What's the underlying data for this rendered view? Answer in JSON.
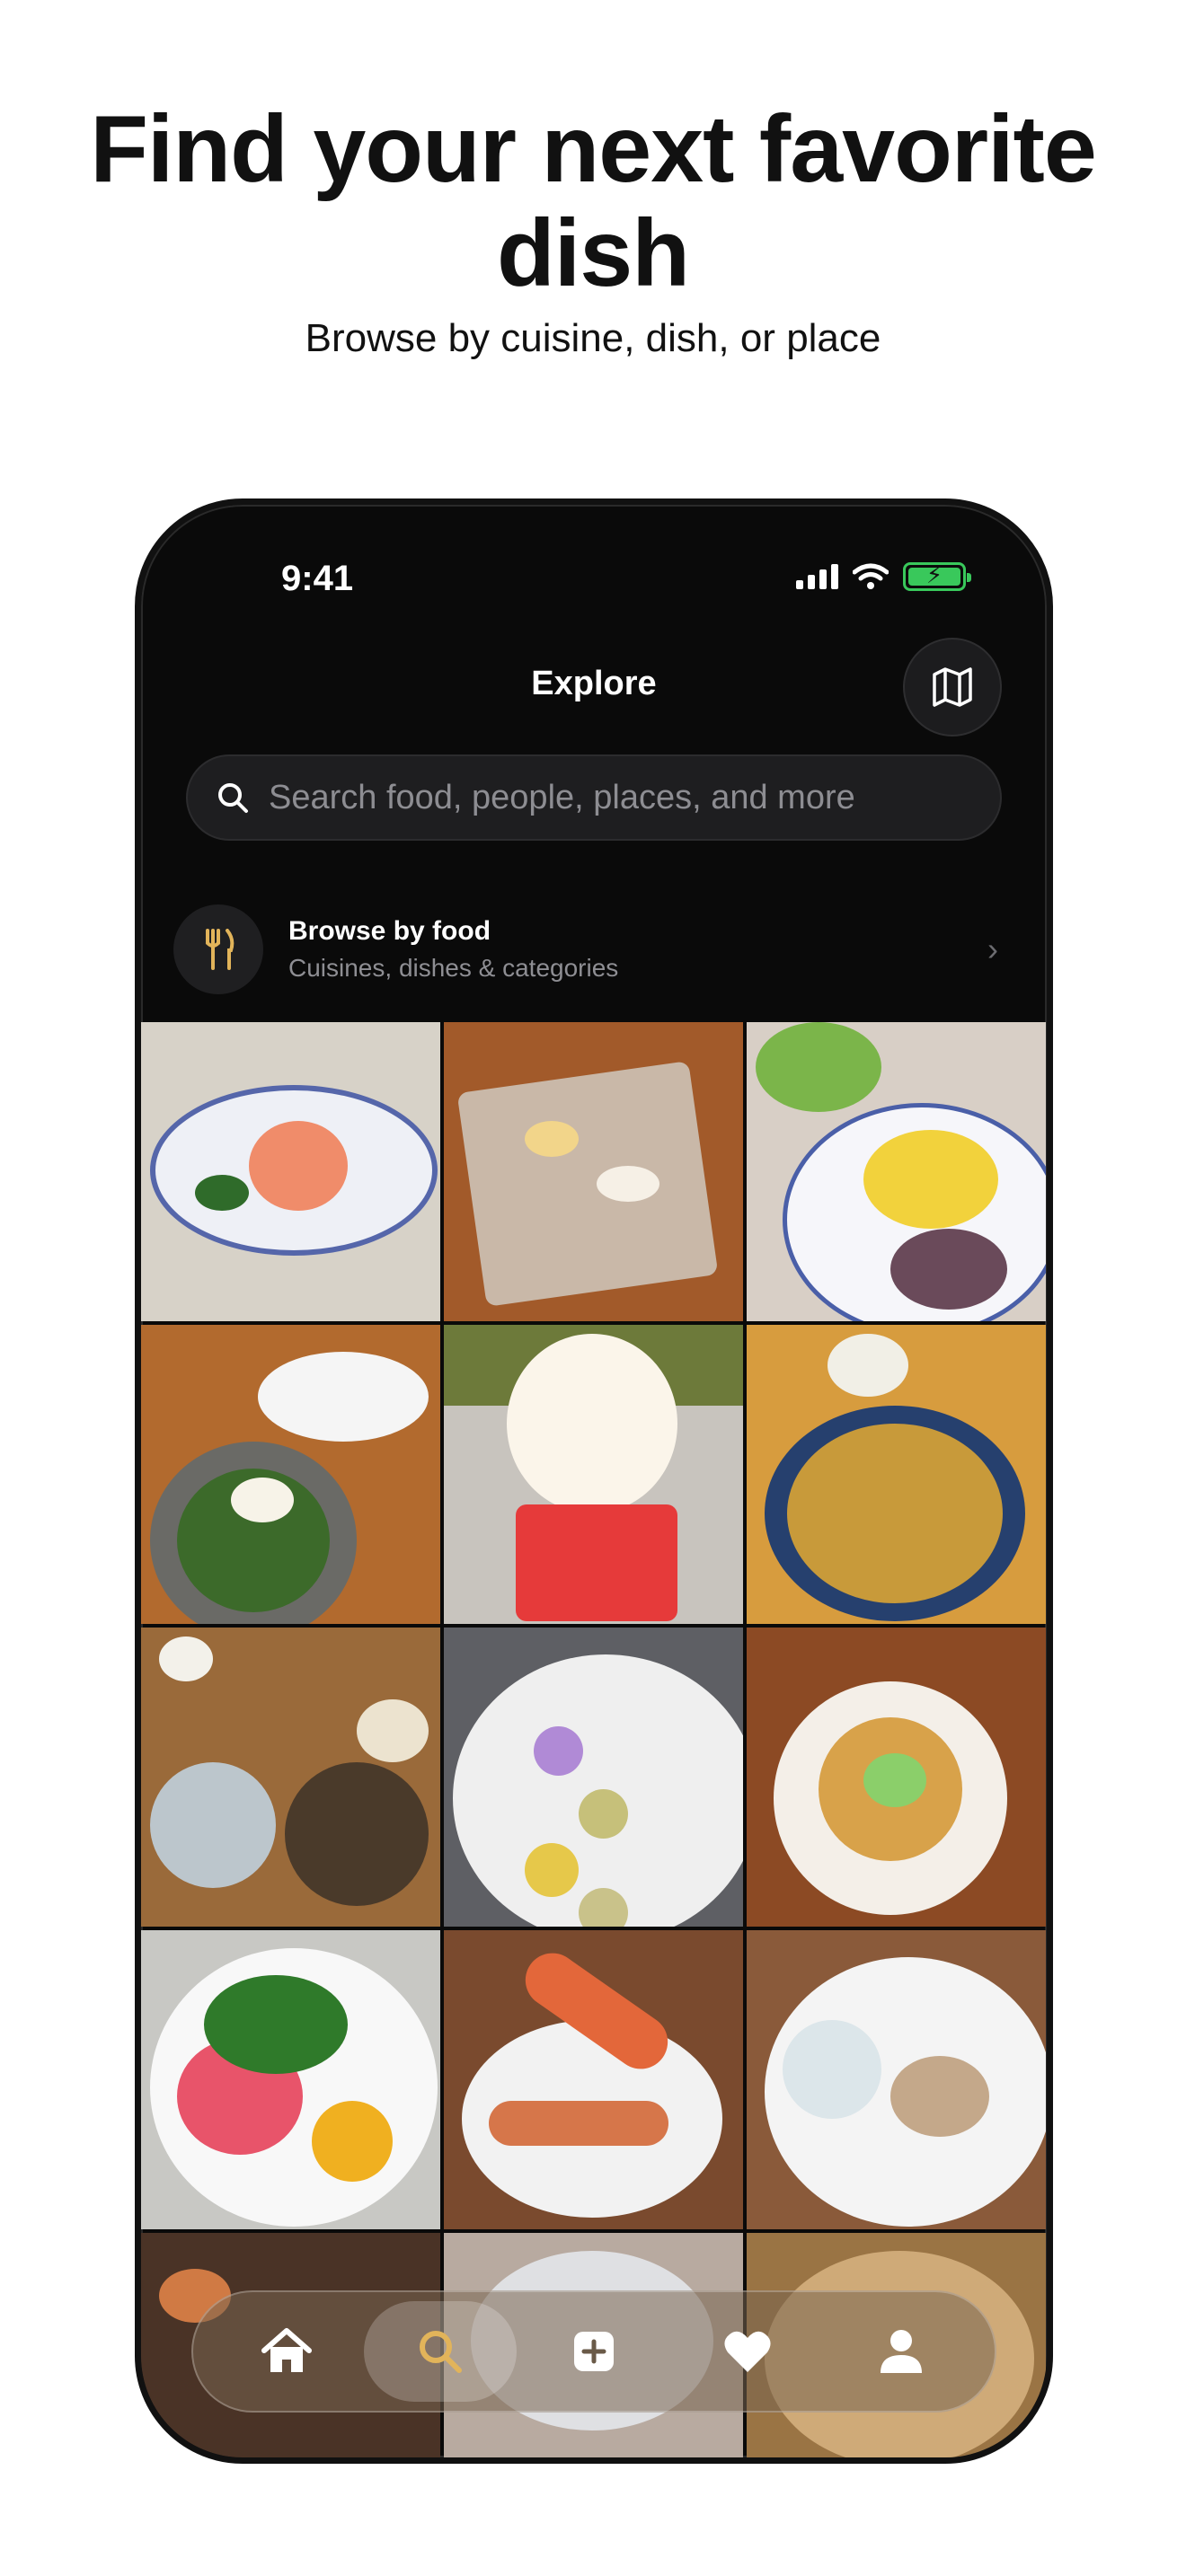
{
  "header": {
    "headline": "Find your next favorite dish",
    "subhead": "Browse by cuisine, dish, or place"
  },
  "status_bar": {
    "time": "9:41"
  },
  "nav": {
    "title": "Explore"
  },
  "search": {
    "placeholder": "Search food, people, places, and more"
  },
  "browse": {
    "title": "Browse by food",
    "subtitle": "Cuisines, dishes & categories"
  },
  "grid": {
    "photos": [
      {
        "name": "sashimi-platter"
      },
      {
        "name": "sushi-board"
      },
      {
        "name": "breakfast-plate"
      },
      {
        "name": "bibimbap-set"
      },
      {
        "name": "soft-serve-cup"
      },
      {
        "name": "fried-noodles"
      },
      {
        "name": "korean-table-set"
      },
      {
        "name": "macarons-plate"
      },
      {
        "name": "ramen-gyoza"
      },
      {
        "name": "poke-bowl"
      },
      {
        "name": "king-crab-legs"
      },
      {
        "name": "fine-dining-plate"
      },
      {
        "name": "grill-table"
      },
      {
        "name": "bowl-dish"
      },
      {
        "name": "dumplings-steamer"
      }
    ]
  },
  "tabbar": {
    "tabs": [
      {
        "name": "home",
        "active": false
      },
      {
        "name": "search",
        "active": true
      },
      {
        "name": "add",
        "active": false
      },
      {
        "name": "favorites",
        "active": false
      },
      {
        "name": "profile",
        "active": false
      }
    ]
  },
  "colors": {
    "background": "#0a0a0a",
    "accent": "#e2b45a",
    "battery": "#39c85b"
  }
}
